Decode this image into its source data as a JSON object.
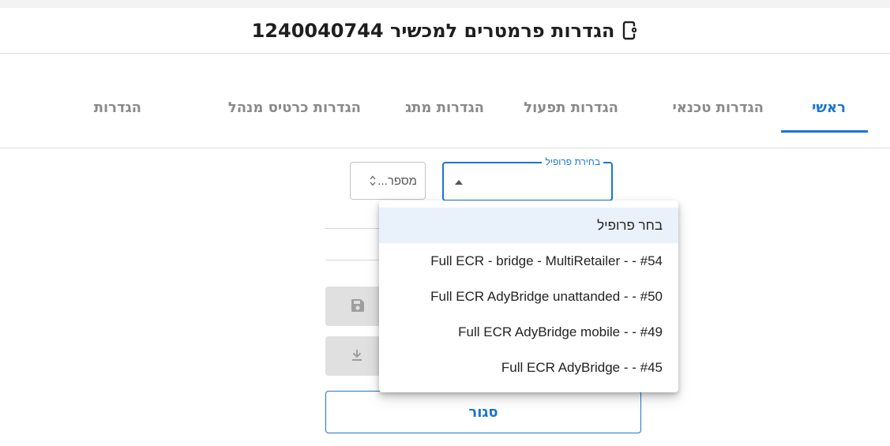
{
  "dialog": {
    "title": "הגדרות פרמטרים למכשיר 1240040744",
    "icon": "device-settings-icon"
  },
  "tabs": [
    {
      "label": "ראשי",
      "active": true
    },
    {
      "label": "הגדרות טכנאי",
      "active": false
    },
    {
      "label": "הגדרות תפעול",
      "active": false
    },
    {
      "label": "הגדרות מתג",
      "active": false
    },
    {
      "label": "הגדרות כרטיס מנהל",
      "active": false
    },
    {
      "label": "הגדרות",
      "active": false
    }
  ],
  "form": {
    "number_field": {
      "label": "מספר..."
    },
    "profile_select": {
      "legend": "בחירת פרופיל",
      "value": ""
    }
  },
  "buttons": {
    "save_icon": "save-icon",
    "download_icon": "download-icon",
    "close_label": "סגור"
  },
  "profile_menu": {
    "options": [
      "בחר פרופיל",
      "Full ECR - bridge - MultiRetailer - - #54",
      "Full ECR AdyBridge unattanded - - #50",
      "Full ECR AdyBridge mobile - - #49",
      "Full ECR AdyBridge - - #45"
    ],
    "selected_index": 0
  },
  "colors": {
    "accent": "#1976d2",
    "inactive_tab": "#8a8a8a",
    "selected_option_bg": "#e9f1fa",
    "disabled_button_bg": "#e0e0e0"
  }
}
